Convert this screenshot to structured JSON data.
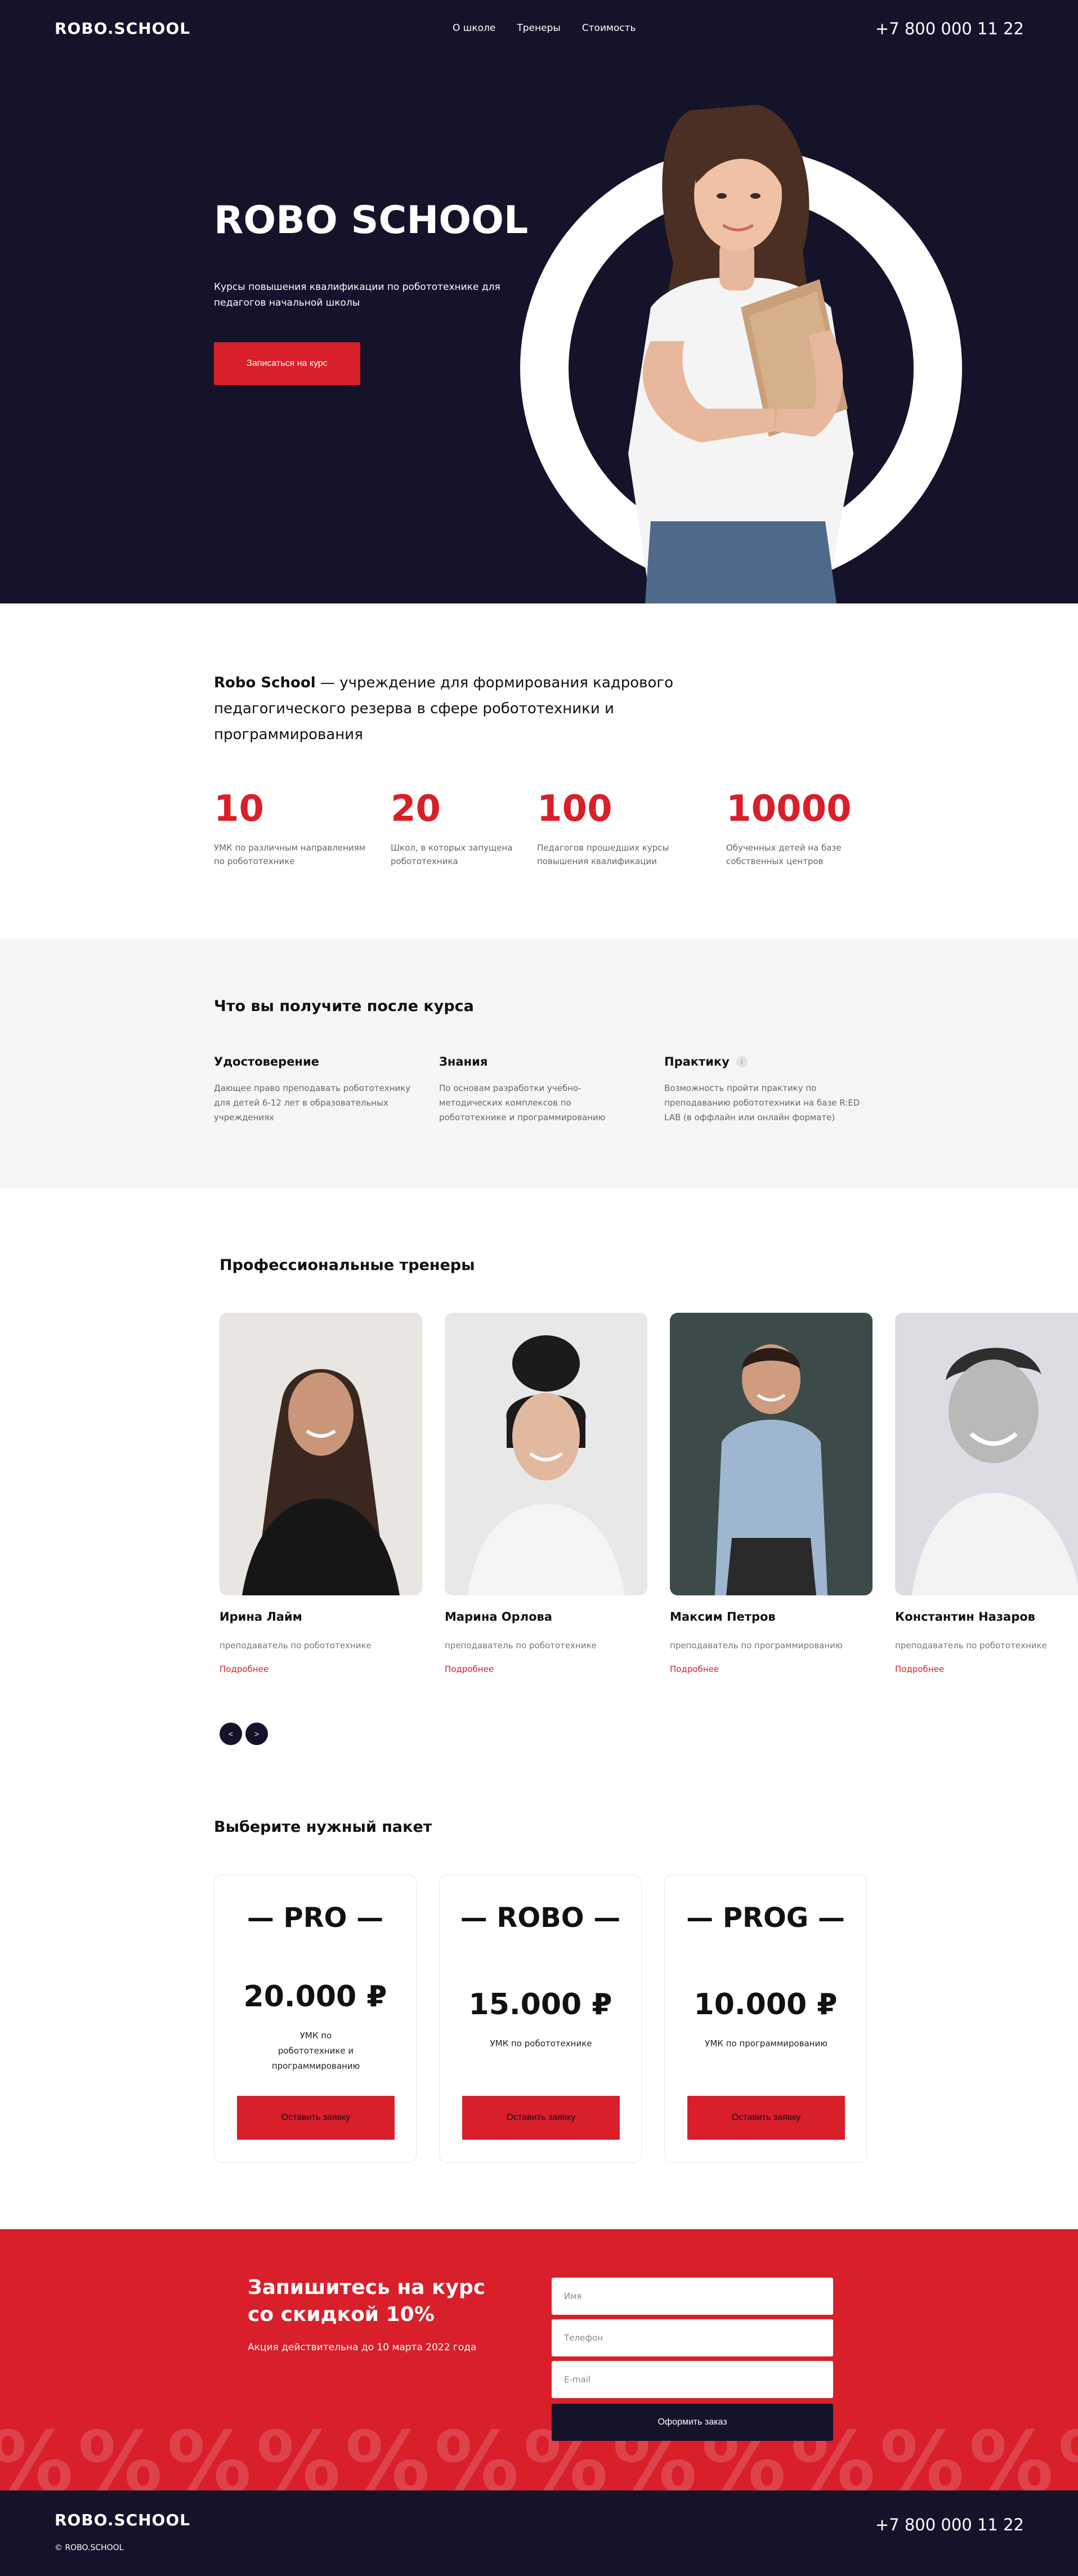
{
  "header": {
    "logo": "ROBO.SCHOOL",
    "nav": [
      "О школе",
      "Тренеры",
      "Стоимость"
    ],
    "phone": "+7 800 000 11 22"
  },
  "hero": {
    "title": "ROBO SCHOOL",
    "subtitle": "Курсы повышения квалификации по робототехнике для педагогов начальной школы",
    "cta": "Записаться на курс"
  },
  "about": {
    "lead_brand": "Robo School",
    "lead_rest": " — учреждение для формирования кадрового педагогического резерва в сфере робототехники и программирования",
    "stats": [
      {
        "value": "10",
        "text": "УМК по различным направлениям по робототехнике"
      },
      {
        "value": "20",
        "text": "Школ, в которых запущена робототехника"
      },
      {
        "value": "100",
        "text": "Педагогов прошедших курсы повышения квалификации"
      },
      {
        "value": "10000",
        "text": "Обученных детей на базе собственных центров"
      }
    ]
  },
  "benefits": {
    "title": "Что вы получите после курса",
    "items": [
      {
        "title": "Удостоверение",
        "text": "Дающее право преподавать робототехнику для детей 6-12 лет в образовательных учреждениях"
      },
      {
        "title": "Знания",
        "text": "По основам разработки учебно-методических комплексов по робототехнике и программированию"
      },
      {
        "title": "Практику",
        "text": "Возможность пройти практику по преподаванию робототехники на базе R:ED LAB (в оффлайн или онлайн формате)",
        "info": "i"
      }
    ]
  },
  "trainers": {
    "title": "Профессиональные тренеры",
    "more_label": "Подробнее",
    "items": [
      {
        "name": "Ирина Лайм",
        "role": "преподаватель по робототехнике"
      },
      {
        "name": "Марина Орлова",
        "role": "преподаватель по робототехнике"
      },
      {
        "name": "Максим Петров",
        "role": "преподаватель по программированию"
      },
      {
        "name": "Константин Назаров",
        "role": "преподаватель по робототехнике"
      }
    ],
    "prev": "<",
    "next": ">"
  },
  "packages": {
    "title": "Выберите нужный пакет",
    "button_label": "Оставить заявку",
    "items": [
      {
        "name": "— PRO —",
        "price": "20.000 ₽",
        "desc": "УМК по робототехнике и программированию"
      },
      {
        "name": "— ROBO —",
        "price": "15.000 ₽",
        "desc": "УМК по робототехнике"
      },
      {
        "name": "— PROG —",
        "price": "10.000 ₽",
        "desc": "УМК по программированию"
      }
    ]
  },
  "signup": {
    "title": "Запишитесь на курс со скидкой 10%",
    "note": "Акция действительна до 10 марта 2022 года",
    "placeholders": {
      "name": "Имя",
      "phone": "Телефон",
      "email": "E-mail"
    },
    "submit": "Оформить заказ",
    "pattern": "%%%%%%%%%%%%%%%%%%%"
  },
  "footer": {
    "logo": "ROBO.SCHOOL",
    "copyright": "© ROBO.SCHOOL",
    "phone": "+7 800 000 11 22"
  },
  "colors": {
    "accent": "#d81f2a",
    "dark": "#15132a",
    "light_bg": "#f6f6f6"
  }
}
